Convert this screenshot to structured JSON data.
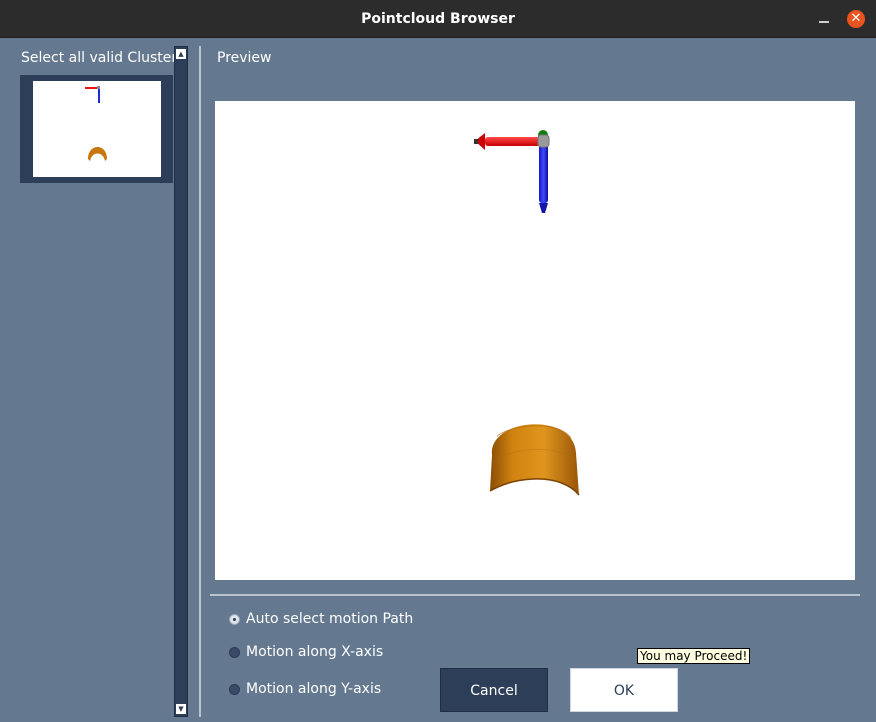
{
  "window": {
    "title": "Pointcloud Browser",
    "minimize_icon": "minimize-icon",
    "close_icon": "close-icon",
    "close_glyph": "✕"
  },
  "clusters_panel": {
    "title": "Select all valid Clusters",
    "thumbnail_count": 1,
    "scroll_up_glyph": "▲",
    "scroll_down_glyph": "▼"
  },
  "preview": {
    "label": "Preview",
    "axes_colors": {
      "x": "#ee1111",
      "y": "#1a2bd6",
      "z": "#117a11",
      "origin": "#9a9a9a"
    },
    "cluster_color": "#c9760e"
  },
  "motion_options": [
    {
      "label": "Auto select motion Path",
      "selected": true
    },
    {
      "label": "Motion along X-axis",
      "selected": false
    },
    {
      "label": "Motion along Y-axis",
      "selected": false
    }
  ],
  "buttons": {
    "cancel": "Cancel",
    "ok": "OK"
  },
  "tooltip": "You may Proceed!",
  "colors": {
    "background": "#647990",
    "panel_dark": "#2c3e58",
    "titlebar": "#2c2c2c",
    "close_button": "#e95420"
  }
}
